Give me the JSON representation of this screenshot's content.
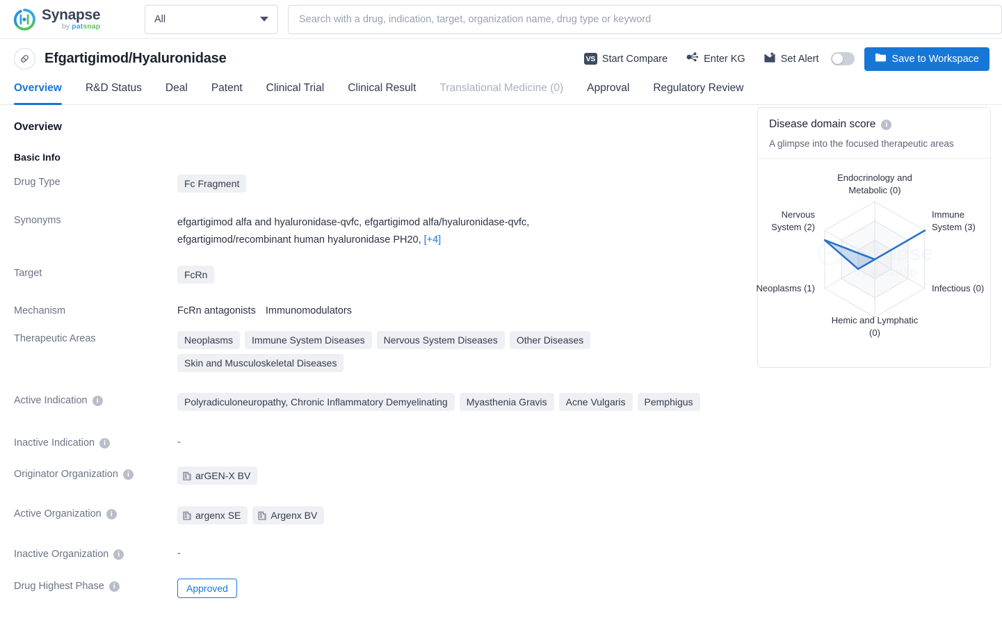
{
  "brand": {
    "name": "Synapse",
    "by": "by ",
    "pat": "pat",
    "snap": "snap"
  },
  "search": {
    "scope_value": "All",
    "placeholder": "Search with a drug, indication, target, organization name, drug type or keyword",
    "value": ""
  },
  "drug_header": {
    "title": "Efgartigimod/Hyaluronidase",
    "actions": {
      "start_compare": "Start Compare",
      "vs_badge": "VS",
      "enter_kg": "Enter KG",
      "set_alert": "Set Alert",
      "save_workspace": "Save to Workspace"
    }
  },
  "tabs": [
    {
      "label": "Overview",
      "state": "active"
    },
    {
      "label": "R&D Status",
      "state": "normal"
    },
    {
      "label": "Deal",
      "state": "normal"
    },
    {
      "label": "Patent",
      "state": "normal"
    },
    {
      "label": "Clinical Trial",
      "state": "normal"
    },
    {
      "label": "Clinical Result",
      "state": "normal"
    },
    {
      "label": "Translational Medicine (0)",
      "state": "disabled"
    },
    {
      "label": "Approval",
      "state": "normal"
    },
    {
      "label": "Regulatory Review",
      "state": "normal"
    }
  ],
  "overview": {
    "section_title": "Overview",
    "basic_info_title": "Basic Info",
    "labels": {
      "drug_type": "Drug Type",
      "synonyms": "Synonyms",
      "target": "Target",
      "mechanism": "Mechanism",
      "therapeutic_areas": "Therapeutic Areas",
      "active_indication": "Active Indication",
      "inactive_indication": "Inactive Indication",
      "originator_organization": "Originator Organization",
      "active_organization": "Active Organization",
      "inactive_organization": "Inactive Organization",
      "drug_highest_phase": "Drug Highest Phase"
    },
    "drug_type": [
      "Fc Fragment"
    ],
    "synonyms_line1": "efgartigimod alfa and hyaluronidase-qvfc,  efgartigimod alfa/hyaluronidase-qvfc,",
    "synonyms_line2": "efgartigimod/recombinant human hyaluronidase PH20,",
    "synonyms_more": "[+4]",
    "target": [
      "FcRn"
    ],
    "mechanism": [
      "FcRn antagonists",
      "Immunomodulators"
    ],
    "therapeutic_areas": [
      "Neoplasms",
      "Immune System Diseases",
      "Nervous System Diseases",
      "Other Diseases",
      "Skin and Musculoskeletal Diseases"
    ],
    "active_indication": [
      "Polyradiculoneuropathy, Chronic Inflammatory Demyelinating",
      "Myasthenia Gravis",
      "Acne Vulgaris",
      "Pemphigus"
    ],
    "inactive_indication": "-",
    "originator_organization": [
      "arGEN-X BV"
    ],
    "active_organization": [
      "argenx SE",
      "Argenx BV"
    ],
    "inactive_organization": "-",
    "drug_highest_phase": "Approved"
  },
  "radar_card": {
    "title": "Disease domain score",
    "subtitle": "A glimpse into the focused therapeutic areas",
    "watermark_word": "Synapse",
    "watermark_by": "by ",
    "watermark_pat": "pat",
    "watermark_snap": "snap"
  },
  "chart_data": {
    "type": "radar",
    "title": "Disease domain score",
    "subtitle": "A glimpse into the focused therapeutic areas",
    "categories": [
      "Endocrinology and Metabolic",
      "Immune System",
      "Infectious",
      "Hemic and Lymphatic",
      "Neoplasms",
      "Nervous System"
    ],
    "tick_labels": [
      "Endocrinology and Metabolic (0)",
      "Immune System (3)",
      "Infectious (0)",
      "Hemic and Lymphatic (0)",
      "Neoplasms (1)",
      "Nervous System (2)"
    ],
    "values": [
      0,
      3,
      0,
      0,
      1,
      2
    ],
    "rmax": 3,
    "rings": 3,
    "grid": true,
    "legend": false,
    "series": [
      {
        "name": "Disease domain score",
        "values": [
          0,
          3,
          0,
          0,
          1,
          2
        ]
      }
    ],
    "colors": {
      "line": "#2a72c8",
      "fill": "#2a72c8",
      "grid": "#dcdfe4"
    }
  },
  "colors": {
    "accent": "#1677d8",
    "tag_bg": "#eef0f4",
    "label_text": "#6b7387",
    "title_text": "#13192a",
    "disabled_tab": "#a9b0bd",
    "toggle_off": "#ccd0d9",
    "radar_line": "#2a72c8"
  },
  "icons": {
    "logo": "synapse-logo-icon",
    "scope_caret": "chevron-down-icon",
    "drug": "pill-icon",
    "compare": "vs-badge-icon",
    "kg": "knowledge-graph-icon",
    "alert": "envelope-up-icon",
    "workspace": "folder-icon",
    "info": "info-icon",
    "building": "building-icon"
  }
}
